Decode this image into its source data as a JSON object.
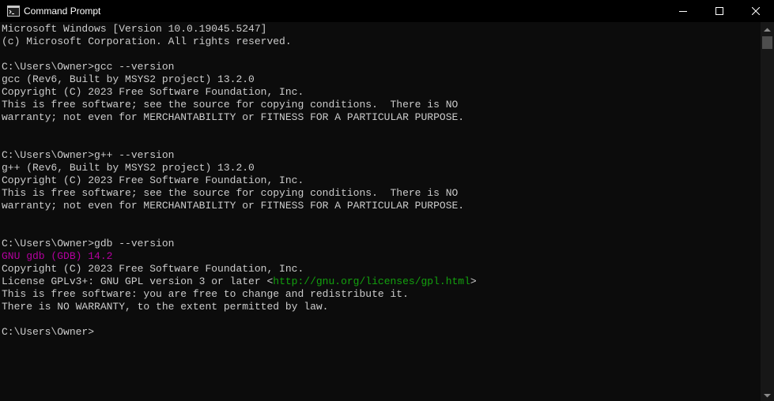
{
  "window": {
    "title": "Command Prompt"
  },
  "console": {
    "lines": {
      "l0": "Microsoft Windows [Version 10.0.19045.5247]",
      "l1": "(c) Microsoft Corporation. All rights reserved.",
      "l3": "C:\\Users\\Owner>gcc --version",
      "l4": "gcc (Rev6, Built by MSYS2 project) 13.2.0",
      "l5": "Copyright (C) 2023 Free Software Foundation, Inc.",
      "l6": "This is free software; see the source for copying conditions.  There is NO",
      "l7": "warranty; not even for MERCHANTABILITY or FITNESS FOR A PARTICULAR PURPOSE.",
      "l10": "C:\\Users\\Owner>g++ --version",
      "l11": "g++ (Rev6, Built by MSYS2 project) 13.2.0",
      "l12": "Copyright (C) 2023 Free Software Foundation, Inc.",
      "l13": "This is free software; see the source for copying conditions.  There is NO",
      "l14": "warranty; not even for MERCHANTABILITY or FITNESS FOR A PARTICULAR PURPOSE.",
      "l17": "C:\\Users\\Owner>gdb --version",
      "l18": "GNU gdb (GDB) 14.2",
      "l19": "Copyright (C) 2023 Free Software Foundation, Inc.",
      "l20_pre": "License GPLv3+: GNU GPL version 3 or later <",
      "l20_url": "http://gnu.org/licenses/gpl.html",
      "l20_post": ">",
      "l21": "This is free software: you are free to change and redistribute it.",
      "l22": "There is NO WARRANTY, to the extent permitted by law.",
      "l24": "C:\\Users\\Owner>"
    }
  },
  "colors": {
    "background": "#0c0c0c",
    "foreground": "#cccccc",
    "gdb_version": "#b4009e",
    "license_url": "#13a10e",
    "titlebar": "#000000"
  },
  "icons": {
    "app": "console-icon",
    "minimize": "minimize-icon",
    "maximize": "maximize-icon",
    "close": "close-icon"
  }
}
